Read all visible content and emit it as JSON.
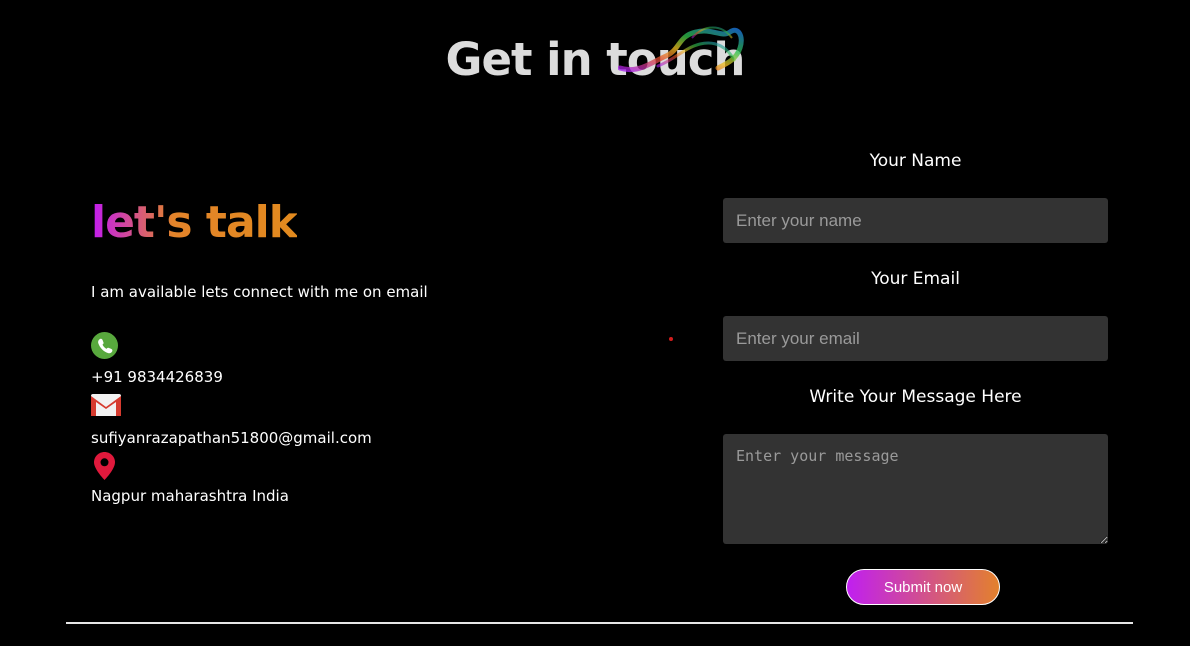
{
  "header": {
    "title": "Get in touch",
    "smoke_icon": "rainbow-smoke-icon"
  },
  "left": {
    "heading": "let's talk",
    "availability": "I am available lets connect with me on email",
    "contacts": [
      {
        "icon": "phone-icon",
        "text": "+91 9834426839"
      },
      {
        "icon": "gmail-icon",
        "text": "sufiyanrazapathan51800@gmail.com"
      },
      {
        "icon": "location-pin-icon",
        "text": "Nagpur maharashtra India"
      }
    ]
  },
  "form": {
    "name_label": "Your Name",
    "name_placeholder": "Enter your name",
    "email_label": "Your Email",
    "email_placeholder": "Enter your email",
    "message_label": "Write Your Message Here",
    "message_placeholder": "Enter your message",
    "submit_label": "Submit now"
  },
  "colors": {
    "background": "#000000",
    "input_bg": "#333333",
    "gradient_start": "#c21bf2",
    "gradient_end": "#e3842a"
  }
}
